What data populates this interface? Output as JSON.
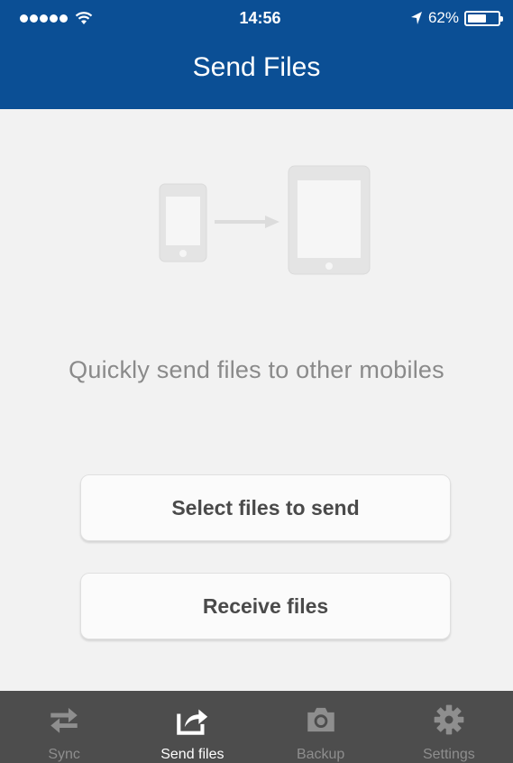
{
  "status_bar": {
    "time": "14:56",
    "battery_percent": "62%",
    "battery_level": 0.62,
    "signal_bars": 5,
    "icons": [
      "signal-dots-icon",
      "wifi-icon",
      "location-arrow-icon",
      "battery-icon"
    ]
  },
  "header": {
    "title": "Send Files",
    "background_color": "#0b4f95"
  },
  "main": {
    "illustration_icons": [
      "phone-icon",
      "arrow-right-icon",
      "tablet-icon"
    ],
    "tagline": "Quickly send files to other mobiles",
    "buttons": {
      "select": "Select files to send",
      "receive": "Receive files"
    }
  },
  "tabbar": {
    "tabs": [
      {
        "label": "Sync",
        "icon": "sync-arrows-icon",
        "active": false
      },
      {
        "label": "Send files",
        "icon": "share-arrow-icon",
        "active": true
      },
      {
        "label": "Backup",
        "icon": "camera-icon",
        "active": false
      },
      {
        "label": "Settings",
        "icon": "gear-icon",
        "active": false
      }
    ]
  }
}
